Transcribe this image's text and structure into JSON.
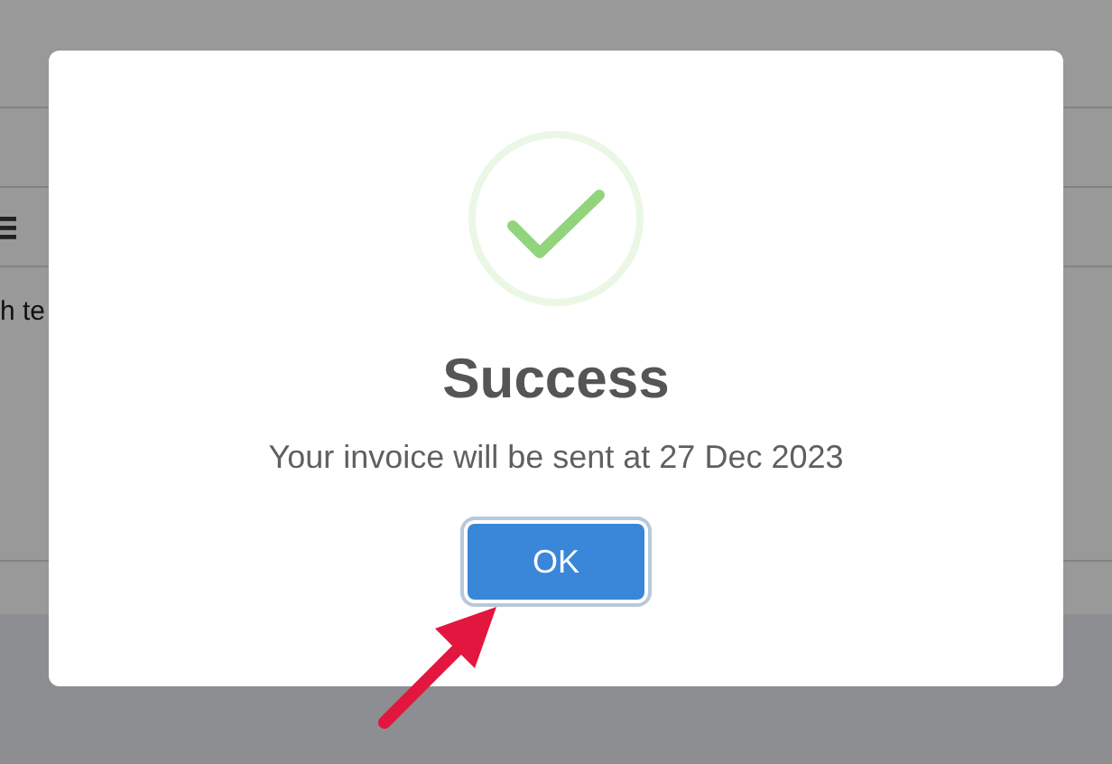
{
  "background": {
    "text": "h te"
  },
  "dialog": {
    "title": "Success",
    "message": "Your invoice will be sent at 27 Dec 2023",
    "buttons": [
      {
        "label": "OK",
        "focused": true
      }
    ]
  }
}
